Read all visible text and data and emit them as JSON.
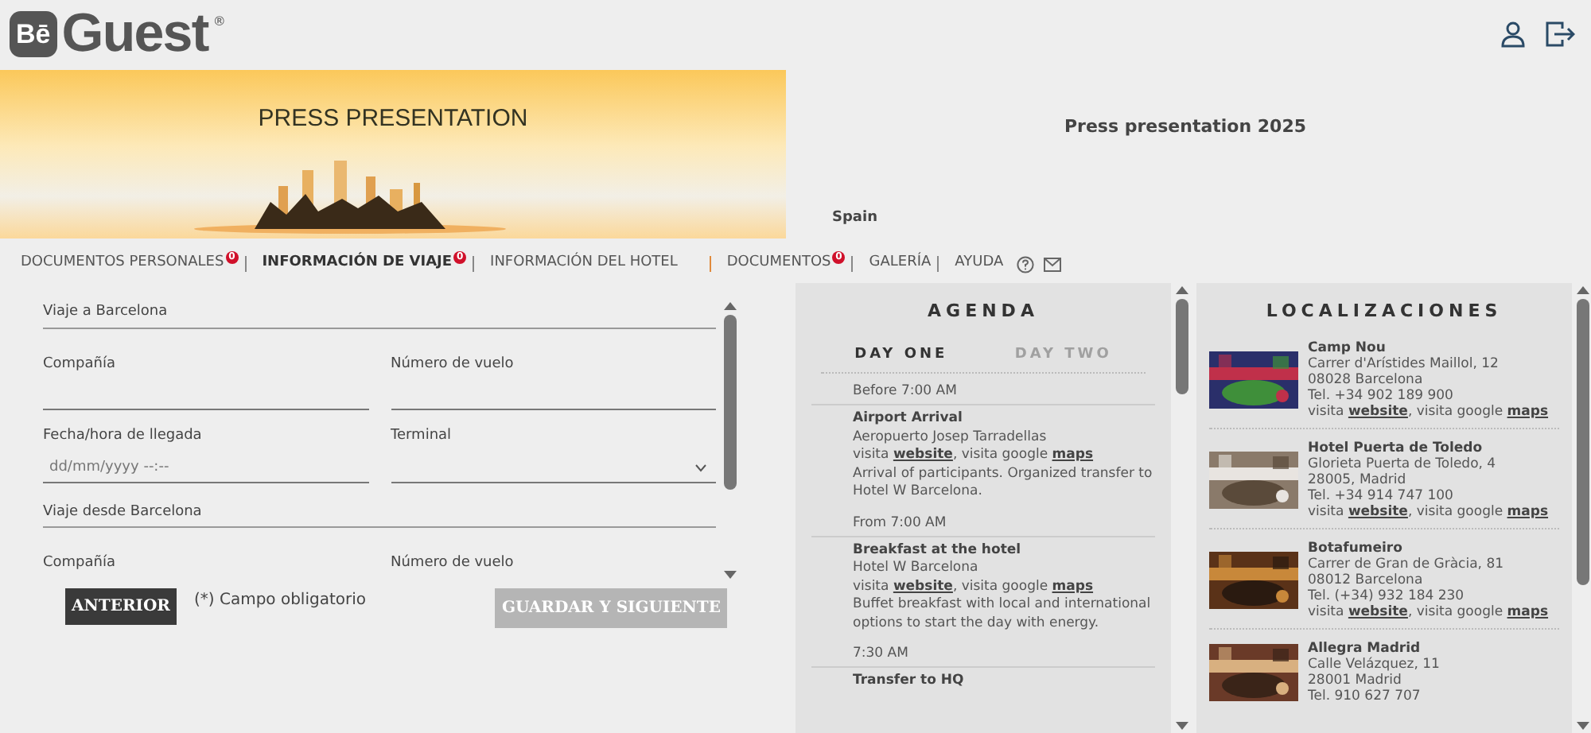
{
  "logo": {
    "mark": "Bē",
    "name": "Guest",
    "registered": "®"
  },
  "banner": {
    "title": "PRESS PRESENTATION"
  },
  "event": {
    "title": "Press presentation 2025",
    "country": "Spain"
  },
  "nav": [
    {
      "label": "DOCUMENTOS PERSONALES",
      "badge": "0",
      "selected": false
    },
    {
      "label": "INFORMACIÓN DE VIAJE",
      "badge": "0",
      "selected": true
    },
    {
      "label": "INFORMACIÓN DEL HOTEL",
      "selected": false
    },
    {
      "label": "DOCUMENTOS",
      "badge": "0",
      "selected": false
    },
    {
      "label": "GALERÍA",
      "selected": false
    },
    {
      "label": "AYUDA",
      "selected": false
    }
  ],
  "form": {
    "sections": [
      {
        "title": "Viaje a Barcelona",
        "fields": [
          {
            "label": "Compañía",
            "kind": "text"
          },
          {
            "label": "Número de vuelo",
            "kind": "text"
          },
          {
            "label": "Fecha/hora de llegada",
            "kind": "datetime",
            "placeholder": "dd/mm/yyyy --:--"
          },
          {
            "label": "Terminal",
            "kind": "select"
          }
        ]
      },
      {
        "title": "Viaje desde Barcelona",
        "fields": [
          {
            "label": "Compañía",
            "kind": "label"
          },
          {
            "label": "Número de vuelo",
            "kind": "label"
          }
        ]
      }
    ],
    "back": "ANTERIOR",
    "required_note": "(*) Campo obligatorio",
    "next": {
      "label": "GUARDAR Y SIGUIENTE",
      "disabled": true
    }
  },
  "agenda": {
    "title": "AGENDA",
    "days": [
      {
        "label": "DAY ONE",
        "selected": true
      },
      {
        "label": "DAY TWO",
        "selected": false
      }
    ],
    "items": [
      {
        "time": "Before 7:00 AM",
        "title": "Airport Arrival",
        "place": "Aeropuerto Josep Tarradellas",
        "visit": "visita",
        "website": "website",
        "google": ", visita google",
        "maps": "maps",
        "description": "Arrival of participants. Organized transfer to Hotel W Barcelona."
      },
      {
        "time": "From 7:00 AM",
        "title": "Breakfast at the hotel",
        "place": "Hotel W Barcelona",
        "visit": "visita",
        "website": "website",
        "google": ", visita google",
        "maps": "maps",
        "description": "Buffet breakfast with local and international options to start the day with energy."
      },
      {
        "time": "7:30 AM",
        "title": "Transfer to HQ"
      }
    ]
  },
  "locations": {
    "title": "LOCALIZACIONES",
    "items": [
      {
        "name": "Camp Nou",
        "address": "Carrer d'Arístides Maillol, 12",
        "city": "08028 Barcelona",
        "phone": "Tel. +34 902 189 900",
        "visit": "visita",
        "website": "website",
        "google": ", visita google",
        "maps": "maps",
        "kind": "stadium"
      },
      {
        "name": "Hotel Puerta de Toledo",
        "address": "Glorieta Puerta de Toledo, 4",
        "city": "28005, Madrid",
        "phone": "Tel. +34 914 747 100",
        "visit": "visita",
        "website": "website",
        "google": ", visita google",
        "maps": "maps",
        "kind": "room"
      },
      {
        "name": "Botafumeiro",
        "address": "Carrer de Gran de Gràcia, 81",
        "city": "08012 Barcelona",
        "phone": "Tel. (+34) 932 184 230",
        "visit": "visita",
        "website": "website",
        "google": ", visita google",
        "maps": "maps",
        "kind": "restaurant"
      },
      {
        "name": "Allegra Madrid",
        "address": "Calle Velázquez, 11",
        "city": "28001 Madrid",
        "phone": "Tel. 910 627 707",
        "kind": "restaurant2"
      }
    ]
  }
}
